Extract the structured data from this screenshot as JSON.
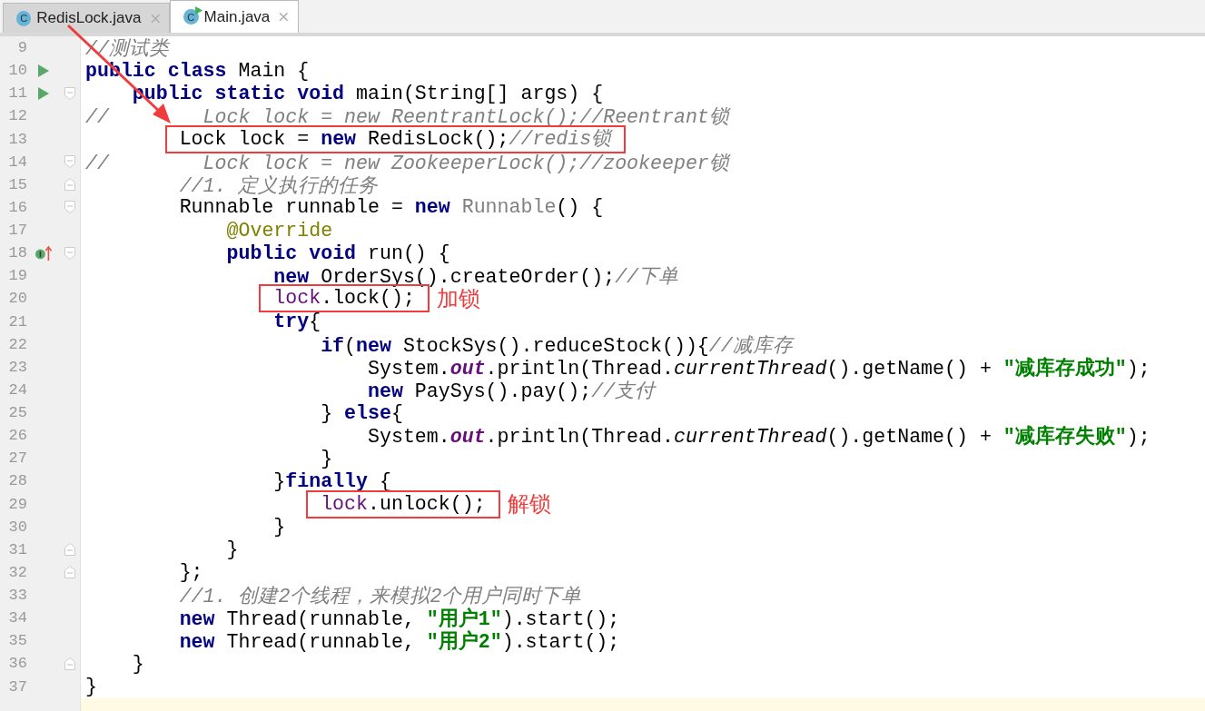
{
  "tabs": [
    {
      "letter": "C",
      "label": "RedisLock.java",
      "selected": false,
      "runnable": false
    },
    {
      "letter": "C",
      "label": "Main.java",
      "selected": true,
      "runnable": true
    }
  ],
  "lines": [
    {
      "number": "9",
      "tokens": [
        {
          "kind": "comment",
          "text": "//测试类"
        }
      ]
    },
    {
      "number": "10",
      "run_marker": true,
      "tokens": [
        {
          "kind": "keyword",
          "text": "public class "
        },
        {
          "kind": "plain",
          "text": "Main {"
        }
      ]
    },
    {
      "number": "11",
      "run_marker": true,
      "fold_start": true,
      "tokens": [
        {
          "kind": "keyword",
          "text": "    public static void "
        },
        {
          "kind": "plain",
          "text": "main(String[] args) {"
        }
      ]
    },
    {
      "number": "12",
      "tokens": [
        {
          "kind": "comment",
          "text": "//        Lock lock = new ReentrantLock();//Reentrant锁"
        }
      ]
    },
    {
      "number": "13",
      "highlight": {
        "tokens": [
          {
            "kind": "plain",
            "text": "        Lock lock = "
          },
          {
            "kind": "keyword",
            "text": "new "
          },
          {
            "kind": "plain",
            "text": "RedisLock();"
          },
          {
            "kind": "comment",
            "text": "//redis锁"
          }
        ]
      }
    },
    {
      "number": "14",
      "fold_start": true,
      "tokens": [
        {
          "kind": "comment",
          "text": "//        Lock lock = new ZookeeperLock();//zookeeper锁"
        }
      ]
    },
    {
      "number": "15",
      "fold_end": true,
      "tokens": [
        {
          "kind": "comment",
          "text": "        //1. 定义执行的任务"
        }
      ]
    },
    {
      "number": "16",
      "fold_start": true,
      "tokens": [
        {
          "kind": "plain",
          "text": "        Runnable runnable = "
        },
        {
          "kind": "keyword",
          "text": "new "
        },
        {
          "kind": "type",
          "text": "Runnable"
        },
        {
          "kind": "plain",
          "text": "() {"
        }
      ]
    },
    {
      "number": "17",
      "tokens": [
        {
          "kind": "annotation",
          "text": "            @Override"
        }
      ]
    },
    {
      "number": "18",
      "implements_marker": true,
      "fold_start": true,
      "tokens": [
        {
          "kind": "keyword",
          "text": "            public void "
        },
        {
          "kind": "plain",
          "text": "run() {"
        }
      ]
    },
    {
      "number": "19",
      "tokens": [
        {
          "kind": "keyword",
          "text": "                new "
        },
        {
          "kind": "plain",
          "text": "OrderSys().createOrder();"
        },
        {
          "kind": "comment",
          "text": "//下单"
        }
      ]
    },
    {
      "number": "20",
      "highlight": {
        "note": "加锁",
        "tokens": [
          {
            "kind": "variable",
            "text": "                lock"
          },
          {
            "kind": "plain",
            "text": ".lock();"
          }
        ]
      }
    },
    {
      "number": "21",
      "tokens": [
        {
          "kind": "keyword",
          "text": "                try"
        },
        {
          "kind": "plain",
          "text": "{"
        }
      ]
    },
    {
      "number": "22",
      "tokens": [
        {
          "kind": "keyword",
          "text": "                    if"
        },
        {
          "kind": "plain",
          "text": "("
        },
        {
          "kind": "keyword",
          "text": "new "
        },
        {
          "kind": "plain",
          "text": "StockSys().reduceStock()){"
        },
        {
          "kind": "comment",
          "text": "//减库存"
        }
      ]
    },
    {
      "number": "23",
      "tokens": [
        {
          "kind": "plain",
          "text": "                        System."
        },
        {
          "kind": "field",
          "text": "out"
        },
        {
          "kind": "plain",
          "text": ".println(Thread."
        },
        {
          "kind": "static",
          "text": "currentThread"
        },
        {
          "kind": "plain",
          "text": "().getName() + "
        },
        {
          "kind": "string",
          "text": "\"减库存成功\""
        },
        {
          "kind": "plain",
          "text": ");"
        }
      ]
    },
    {
      "number": "24",
      "tokens": [
        {
          "kind": "keyword",
          "text": "                        new "
        },
        {
          "kind": "plain",
          "text": "PaySys().pay();"
        },
        {
          "kind": "comment",
          "text": "//支付"
        }
      ]
    },
    {
      "number": "25",
      "tokens": [
        {
          "kind": "plain",
          "text": "                    } "
        },
        {
          "kind": "keyword",
          "text": "else"
        },
        {
          "kind": "plain",
          "text": "{"
        }
      ]
    },
    {
      "number": "26",
      "tokens": [
        {
          "kind": "plain",
          "text": "                        System."
        },
        {
          "kind": "field",
          "text": "out"
        },
        {
          "kind": "plain",
          "text": ".println(Thread."
        },
        {
          "kind": "static",
          "text": "currentThread"
        },
        {
          "kind": "plain",
          "text": "().getName() + "
        },
        {
          "kind": "string",
          "text": "\"减库存失败\""
        },
        {
          "kind": "plain",
          "text": ");"
        }
      ]
    },
    {
      "number": "27",
      "tokens": [
        {
          "kind": "plain",
          "text": "                    }"
        }
      ]
    },
    {
      "number": "28",
      "tokens": [
        {
          "kind": "plain",
          "text": "                }"
        },
        {
          "kind": "keyword",
          "text": "finally "
        },
        {
          "kind": "plain",
          "text": "{"
        }
      ]
    },
    {
      "number": "29",
      "highlight": {
        "note": "解锁",
        "tokens": [
          {
            "kind": "variable",
            "text": "                    lock"
          },
          {
            "kind": "plain",
            "text": ".unlock();"
          }
        ]
      }
    },
    {
      "number": "30",
      "tokens": [
        {
          "kind": "plain",
          "text": "                }"
        }
      ]
    },
    {
      "number": "31",
      "fold_end": true,
      "tokens": [
        {
          "kind": "plain",
          "text": "            }"
        }
      ]
    },
    {
      "number": "32",
      "fold_end": true,
      "tokens": [
        {
          "kind": "plain",
          "text": "        };"
        }
      ]
    },
    {
      "number": "33",
      "tokens": [
        {
          "kind": "comment",
          "text": "        //1. 创建2个线程，来模拟2个用户同时下单"
        }
      ]
    },
    {
      "number": "34",
      "tokens": [
        {
          "kind": "keyword",
          "text": "        new "
        },
        {
          "kind": "plain",
          "text": "Thread(runnable, "
        },
        {
          "kind": "string",
          "text": "\"用户1\""
        },
        {
          "kind": "plain",
          "text": ").start();"
        }
      ]
    },
    {
      "number": "35",
      "tokens": [
        {
          "kind": "keyword",
          "text": "        new "
        },
        {
          "kind": "plain",
          "text": "Thread(runnable, "
        },
        {
          "kind": "string",
          "text": "\"用户2\""
        },
        {
          "kind": "plain",
          "text": ").start();"
        }
      ]
    },
    {
      "number": "36",
      "fold_end": true,
      "tokens": [
        {
          "kind": "plain",
          "text": "    }"
        }
      ]
    },
    {
      "number": "37",
      "tokens": [
        {
          "kind": "plain",
          "text": "}"
        }
      ]
    },
    {
      "current": true
    }
  ]
}
